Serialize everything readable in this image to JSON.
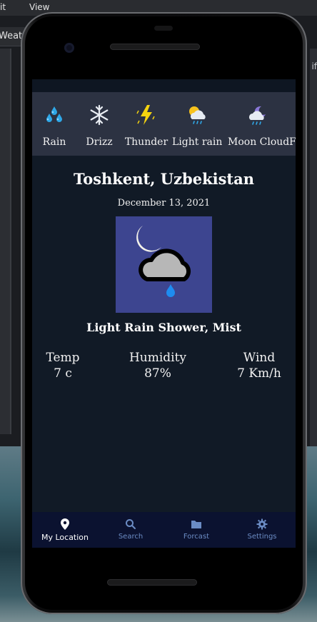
{
  "desktop": {
    "menu": [
      "it",
      "View"
    ],
    "tab_label": "Weat",
    "right_text": "if"
  },
  "conditions": [
    {
      "label": "Rain",
      "icon": "rain-drops-icon"
    },
    {
      "label": "Drizz",
      "icon": "snowflake-icon"
    },
    {
      "label": "Thunder",
      "icon": "lightning-icon"
    },
    {
      "label": "Light rain",
      "icon": "sun-cloud-rain-icon"
    },
    {
      "label": "Moon Cloud",
      "icon": "moon-cloud-icon"
    },
    {
      "label": "F",
      "icon": "partial-icon"
    }
  ],
  "location": {
    "city": "Toshkent, Uzbekistan",
    "date": "December 13, 2021",
    "description": "Light Rain Shower, Mist",
    "icon": "moon-cloud-rain-icon"
  },
  "stats": [
    {
      "label": "Temp",
      "value": "7 c"
    },
    {
      "label": "Humidity",
      "value": "87%"
    },
    {
      "label": "Wind",
      "value": "7 Km/h"
    }
  ],
  "nav": [
    {
      "label": "My Location",
      "icon": "location-pin-icon",
      "active": true
    },
    {
      "label": "Search",
      "icon": "search-icon",
      "active": false
    },
    {
      "label": "Forcast",
      "icon": "folder-icon",
      "active": false
    },
    {
      "label": "Settings",
      "icon": "gear-icon",
      "active": false
    }
  ],
  "colors": {
    "screen_bg": "#111a26",
    "strip_bg": "#2c3242",
    "icon_tile": "#3d4590",
    "nav_bg": "#0b1230",
    "nav_inactive": "#6b8cc4"
  }
}
